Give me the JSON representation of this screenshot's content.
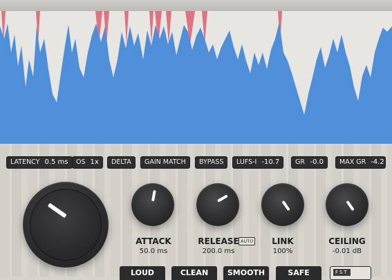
{
  "colors": {
    "waveform": "#4f8ed9",
    "clip": "#e0737f",
    "chip_bg": "#2e2e30",
    "panel_bg": "#d6d2cc"
  },
  "status_bar": [
    {
      "id": "latency",
      "label": "LATENCY",
      "value": "0.5 ms"
    },
    {
      "id": "os",
      "label": "OS",
      "value": "1x"
    },
    {
      "id": "delta",
      "label": "DELTA",
      "value": ""
    },
    {
      "id": "gain_match",
      "label": "GAIN MATCH",
      "value": ""
    },
    {
      "id": "bypass",
      "label": "BYPASS",
      "value": ""
    },
    {
      "id": "lufs",
      "label": "LUFS-I",
      "value": "-10.7"
    },
    {
      "id": "gr",
      "label": "GR",
      "value": "-0.0"
    },
    {
      "id": "max_gr",
      "label": "MAX GR",
      "value": "-4.2"
    }
  ],
  "controls": {
    "attack": {
      "label": "ATTACK",
      "value": "50.0 ms"
    },
    "release": {
      "label": "RELEASE",
      "value": "200.0 ms",
      "badge": "AUTO"
    },
    "link": {
      "label": "LINK",
      "value": "100%"
    },
    "ceiling": {
      "label": "CEILING",
      "value": "-0.01 dB"
    }
  },
  "presets": [
    "LOUD",
    "CLEAN",
    "SMOOTH",
    "SAFE"
  ],
  "fst_label": "FST",
  "icons": {
    "main_knob": "input-gain-knob",
    "small_knob": "rotary-knob"
  }
}
